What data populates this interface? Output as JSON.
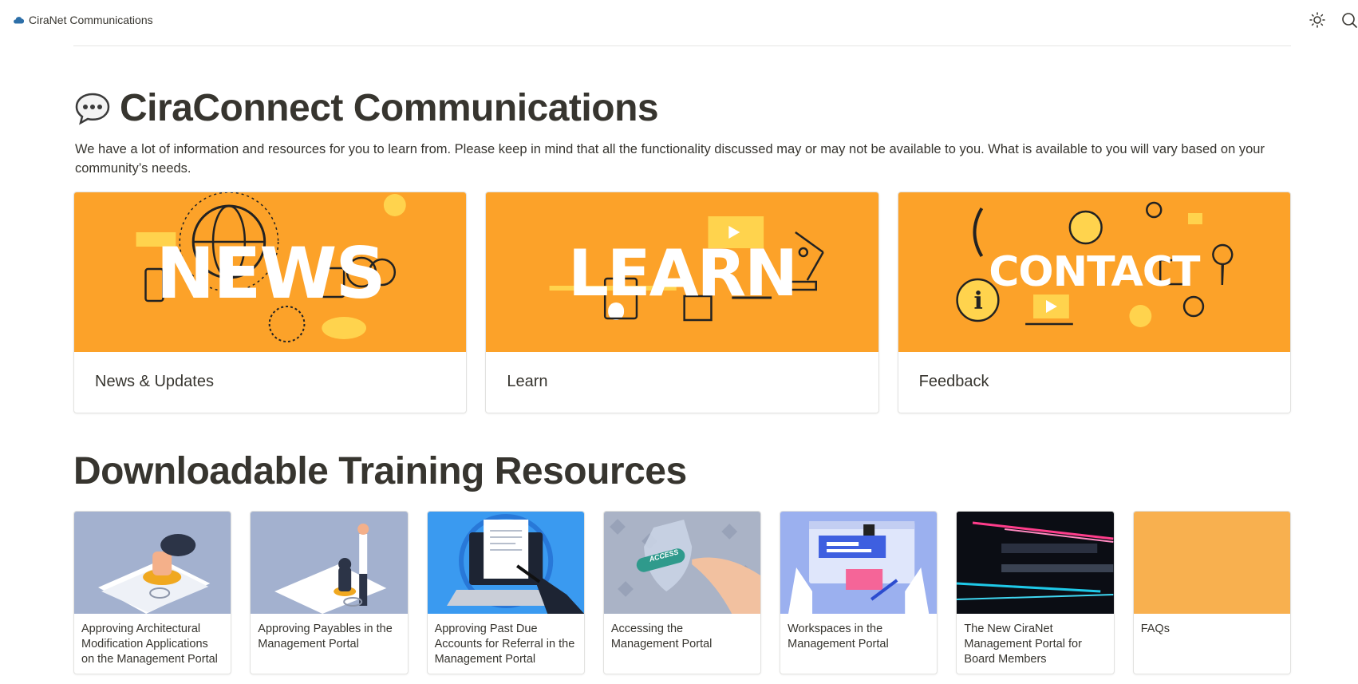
{
  "header": {
    "brand": "CiraNet Communications",
    "icons": [
      "cloud-icon",
      "sun-icon",
      "search-icon"
    ]
  },
  "page": {
    "emoji": "speech-bubble-icon",
    "title": "CiraConnect Communications",
    "intro": "We have a lot of information and resources for you to learn from.  Please keep in mind that all the functionality discussed may or may not be available to you.  What is available to you will vary based on your community’s needs."
  },
  "features": [
    {
      "banner_word": "NEWS",
      "label": "News & Updates"
    },
    {
      "banner_word": "LEARN",
      "label": "Learn"
    },
    {
      "banner_word": "CONTACT",
      "label": "Feedback"
    }
  ],
  "resources_section": {
    "title": "Downloadable Training Resources",
    "items": [
      {
        "label": "Approving Architectural Modification Applications on the Management Portal"
      },
      {
        "label": "Approving Payables in the Management Portal"
      },
      {
        "label": "Approving Past Due Accounts for Referral in the Management Portal"
      },
      {
        "label": "Accessing the Management Portal",
        "thumb_text": "ACCESS"
      },
      {
        "label": "Workspaces in the Management Portal"
      },
      {
        "label": "The New CiraNet Management Portal for Board Members"
      },
      {
        "label": "FAQs"
      }
    ]
  },
  "colors": {
    "banner_orange": "#fca229",
    "faq_thumb": "#f8b04f",
    "text": "#37352f",
    "brand_cloud": "#2d6fa8"
  }
}
